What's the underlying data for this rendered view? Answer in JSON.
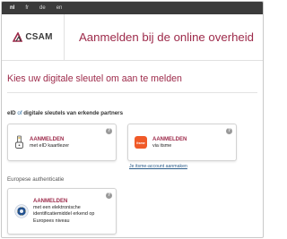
{
  "languages": [
    {
      "code": "nl",
      "active": true
    },
    {
      "code": "fr",
      "active": false
    },
    {
      "code": "de",
      "active": false
    },
    {
      "code": "en",
      "active": false
    }
  ],
  "header": {
    "logo_text": "CSAM",
    "title": "Aanmelden bij de online overheid"
  },
  "page_title": "Kies uw digitale sleutel om aan te melden",
  "section_partners": {
    "prefix": "eID",
    "of": "of",
    "rest": "digitale sleutels van erkende partners"
  },
  "cards": {
    "eid": {
      "label": "AANMELDEN",
      "sub": "met eID kaartlezer",
      "help": "?"
    },
    "itsme": {
      "label": "AANMELDEN",
      "sub": "via itsme",
      "help": "?",
      "logo_text": "itsme",
      "link": "Je itsme-account aanmaken"
    },
    "european": {
      "label": "AANMELDEN",
      "sub": "met een elektronische identificatiemiddel erkend op Europees niveau",
      "help": "?"
    }
  },
  "section_european": "Europese authenticatie",
  "colors": {
    "brand": "#9d2a4a",
    "itsme": "#f05a28",
    "eu_blue": "#1f4f8f"
  }
}
